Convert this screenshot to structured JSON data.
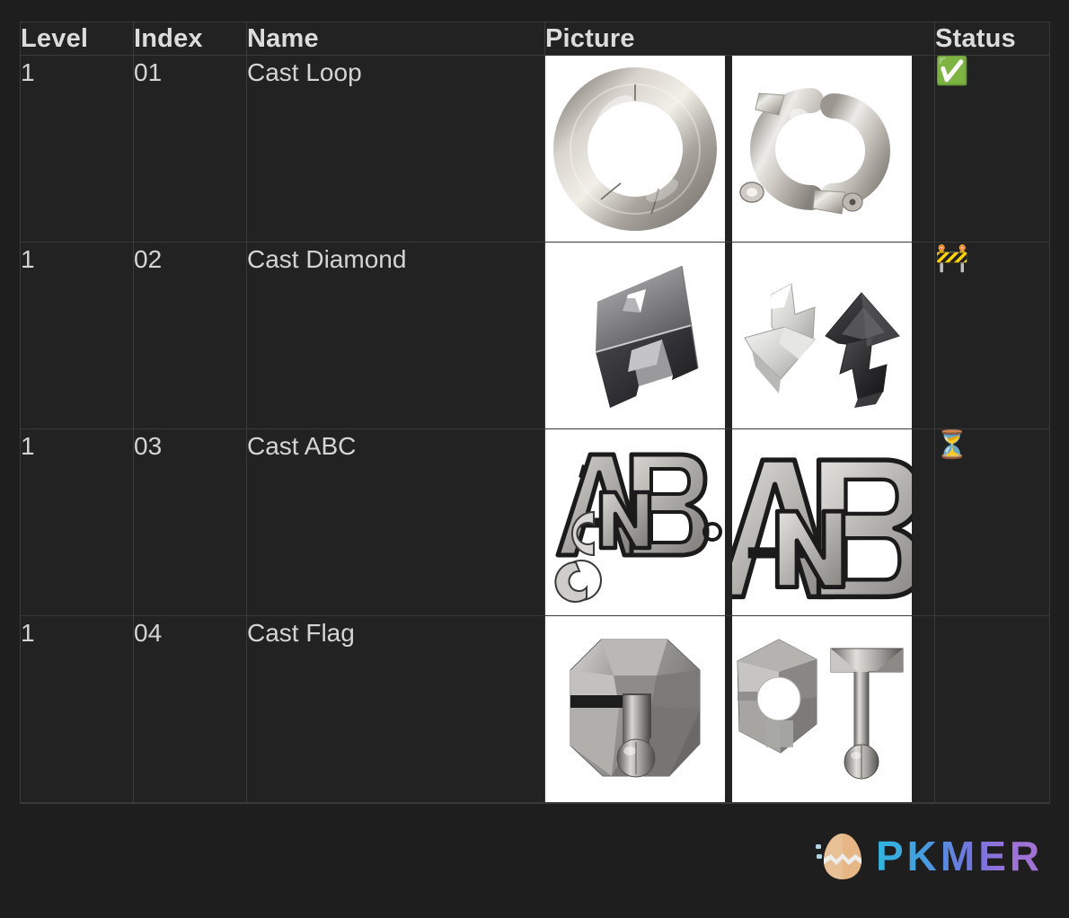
{
  "theme": {
    "page_background": "#1e1e1e",
    "cell_background": "#222222",
    "border_color": "#3a3a3a",
    "header_text_color": "#dcdcdc",
    "body_text_color": "#d4d4d4"
  },
  "table": {
    "columns": [
      {
        "key": "level",
        "label": "Level"
      },
      {
        "key": "index",
        "label": "Index"
      },
      {
        "key": "name",
        "label": "Name"
      },
      {
        "key": "picture",
        "label": "Picture"
      },
      {
        "key": "status",
        "label": "Status"
      }
    ],
    "rows": [
      {
        "level": "1",
        "index": "01",
        "name": "Cast Loop",
        "status": "✅",
        "status_icon_name": "check-mark-button-emoji",
        "pictures": [
          {
            "alt_name": "cast-loop-assembled-ring",
            "kind": "ring-assembled"
          },
          {
            "alt_name": "cast-loop-two-pieces",
            "kind": "ring-pieces"
          }
        ]
      },
      {
        "level": "1",
        "index": "02",
        "name": "Cast Diamond",
        "status": "🚧",
        "status_icon_name": "construction-emoji",
        "pictures": [
          {
            "alt_name": "cast-diamond-assembled",
            "kind": "diamond-assembled"
          },
          {
            "alt_name": "cast-diamond-two-pieces",
            "kind": "diamond-pieces"
          }
        ]
      },
      {
        "level": "1",
        "index": "03",
        "name": "Cast ABC",
        "status": "⏳",
        "status_icon_name": "hourglass-emoji",
        "pictures": [
          {
            "alt_name": "cast-abc-assembled",
            "kind": "abc-full"
          },
          {
            "alt_name": "cast-abc-closeup",
            "kind": "abc-closeup"
          }
        ]
      },
      {
        "level": "1",
        "index": "04",
        "name": "Cast Flag",
        "status": "",
        "status_icon_name": "",
        "pictures": [
          {
            "alt_name": "cast-flag-assembled",
            "kind": "flag-assembled"
          },
          {
            "alt_name": "cast-flag-two-pieces",
            "kind": "flag-pieces"
          }
        ]
      },
      {
        "level": "",
        "index": "",
        "name": "",
        "status": "",
        "status_icon_name": "",
        "pictures": []
      }
    ]
  },
  "watermark": {
    "text": "PKMER",
    "logo_name": "hatching-egg-logo",
    "gradient_start": "#33c3f0",
    "gradient_end": "#b07ae0",
    "logo_color": "#f5b97a"
  }
}
